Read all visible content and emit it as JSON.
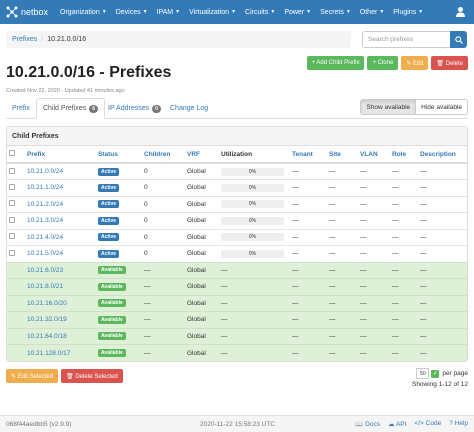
{
  "navbar": {
    "brand": "netbox",
    "items": [
      "Organization",
      "Devices",
      "IPAM",
      "Virtualization",
      "Circuits",
      "Power",
      "Secrets",
      "Other",
      "Plugins"
    ]
  },
  "breadcrumb": {
    "root": "Prefixes",
    "current": "10.21.0.0/16"
  },
  "search": {
    "placeholder": "Search prefixes"
  },
  "actions": {
    "add_child": "+ Add Child Prefix",
    "clone": "+ Clone",
    "edit": "✎ Edit",
    "delete": "🗑 Delete"
  },
  "title": "10.21.0.0/16 - Prefixes",
  "subtitle": "Created Nov 22, 2020 · Updated 41 minutes ago",
  "tabs": [
    {
      "label": "Prefix"
    },
    {
      "label": "Child Prefixes",
      "badge": "6"
    },
    {
      "label": "IP Addresses",
      "badge": "0"
    },
    {
      "label": "Change Log"
    }
  ],
  "toggle": {
    "show": "Show available",
    "hide": "Hide available"
  },
  "panel_title": "Child Prefixes",
  "columns": [
    "Prefix",
    "Status",
    "Children",
    "VRF",
    "Utilization",
    "Tenant",
    "Site",
    "VLAN",
    "Role",
    "Description"
  ],
  "rows": [
    {
      "prefix": "10.21.0.0/24",
      "status": "Active",
      "children": "0",
      "vrf": "Global",
      "util": "0%",
      "util_pct": 0,
      "tenant": "—",
      "site": "—",
      "vlan": "—",
      "role": "—",
      "desc": "—",
      "available": false
    },
    {
      "prefix": "10.21.1.0/24",
      "status": "Active",
      "children": "0",
      "vrf": "Global",
      "util": "0%",
      "util_pct": 0,
      "tenant": "—",
      "site": "—",
      "vlan": "—",
      "role": "—",
      "desc": "—",
      "available": false
    },
    {
      "prefix": "10.21.2.0/24",
      "status": "Active",
      "children": "0",
      "vrf": "Global",
      "util": "0%",
      "util_pct": 0,
      "tenant": "—",
      "site": "—",
      "vlan": "—",
      "role": "—",
      "desc": "—",
      "available": false
    },
    {
      "prefix": "10.21.3.0/24",
      "status": "Active",
      "children": "0",
      "vrf": "Global",
      "util": "0%",
      "util_pct": 0,
      "tenant": "—",
      "site": "—",
      "vlan": "—",
      "role": "—",
      "desc": "—",
      "available": false
    },
    {
      "prefix": "10.21.4.0/24",
      "status": "Active",
      "children": "0",
      "vrf": "Global",
      "util": "0%",
      "util_pct": 0,
      "tenant": "—",
      "site": "—",
      "vlan": "—",
      "role": "—",
      "desc": "—",
      "available": false
    },
    {
      "prefix": "10.21.5.0/24",
      "status": "Active",
      "children": "0",
      "vrf": "Global",
      "util": "0%",
      "util_pct": 0,
      "tenant": "—",
      "site": "—",
      "vlan": "—",
      "role": "—",
      "desc": "—",
      "available": false
    },
    {
      "prefix": "10.21.6.0/23",
      "status": "Available",
      "children": "—",
      "vrf": "Global",
      "util": "—",
      "tenant": "—",
      "site": "—",
      "vlan": "—",
      "role": "—",
      "desc": "—",
      "available": true
    },
    {
      "prefix": "10.21.8.0/21",
      "status": "Available",
      "children": "—",
      "vrf": "Global",
      "util": "—",
      "tenant": "—",
      "site": "—",
      "vlan": "—",
      "role": "—",
      "desc": "—",
      "available": true
    },
    {
      "prefix": "10.21.16.0/20",
      "status": "Available",
      "children": "—",
      "vrf": "Global",
      "util": "—",
      "tenant": "—",
      "site": "—",
      "vlan": "—",
      "role": "—",
      "desc": "—",
      "available": true
    },
    {
      "prefix": "10.21.32.0/19",
      "status": "Available",
      "children": "—",
      "vrf": "Global",
      "util": "—",
      "tenant": "—",
      "site": "—",
      "vlan": "—",
      "role": "—",
      "desc": "—",
      "available": true
    },
    {
      "prefix": "10.21.64.0/18",
      "status": "Available",
      "children": "—",
      "vrf": "Global",
      "util": "—",
      "tenant": "—",
      "site": "—",
      "vlan": "—",
      "role": "—",
      "desc": "—",
      "available": true
    },
    {
      "prefix": "10.21.128.0/17",
      "status": "Available",
      "children": "—",
      "vrf": "Global",
      "util": "—",
      "tenant": "—",
      "site": "—",
      "vlan": "—",
      "role": "—",
      "desc": "—",
      "available": true
    }
  ],
  "bulk": {
    "edit": "✎ Edit Selected",
    "delete": "🗑 Delete Selected"
  },
  "pagination": {
    "per_page_value": "50",
    "per_page_label": "per page",
    "showing": "Showing 1-12 of 12"
  },
  "footer": {
    "version": "068f44aedbb5 (v2.9.9)",
    "timestamp": "2020-11-22 15:58:23 UTC",
    "links": [
      "Docs",
      "API",
      "Code",
      "Help"
    ]
  },
  "colors": {
    "primary": "#337ab7",
    "success": "#5cb85c",
    "warning": "#f0ad4e",
    "danger": "#d9534f",
    "available_row": "#dff0d8"
  }
}
